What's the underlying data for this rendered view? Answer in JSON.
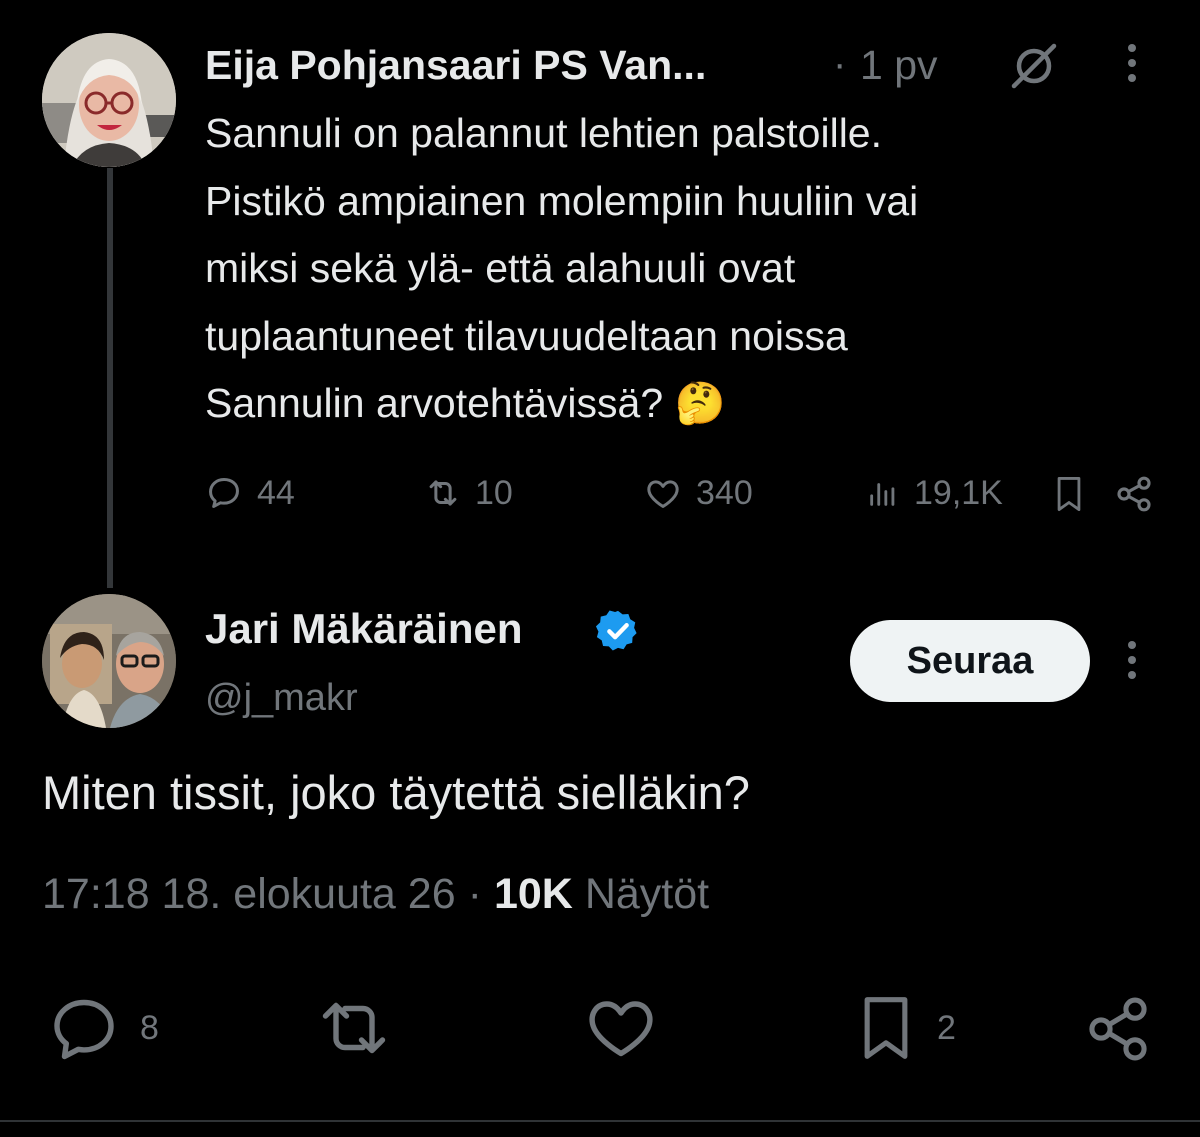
{
  "parent_post": {
    "author_name": "Eija Pohjansaari PS Van...",
    "separator": "·",
    "time": "1 pv",
    "grok_icon": "slash-circle-icon",
    "text_lines": [
      "Sannuli on palannut lehtien palstoille.",
      "Pistikö ampiainen molempiin huuliin vai",
      "miksi sekä ylä- että alahuuli ovat",
      "tuplaantuneet tilavuudeltaan noissa",
      "Sannulin arvotehtävissä? 🤔"
    ],
    "stats": {
      "replies": "44",
      "reposts": "10",
      "likes": "340",
      "views": "19,1K"
    }
  },
  "reply_post": {
    "author_name": "Jari Mäkäräinen",
    "verified": true,
    "handle": "@j_makr",
    "follow_label": "Seuraa",
    "text": "Miten tissit, joko täytettä sielläkin?",
    "timestamp": "17:18 18. elokuuta 26",
    "bullet": "·",
    "views_count": "10K",
    "views_label": "Näytöt",
    "stats": {
      "replies": "8",
      "bookmarks": "2"
    }
  },
  "colors": {
    "background": "#000000",
    "text": "#e7e9ea",
    "muted": "#71767b",
    "verified": "#1d9bf0",
    "button_bg": "#eff3f4"
  }
}
